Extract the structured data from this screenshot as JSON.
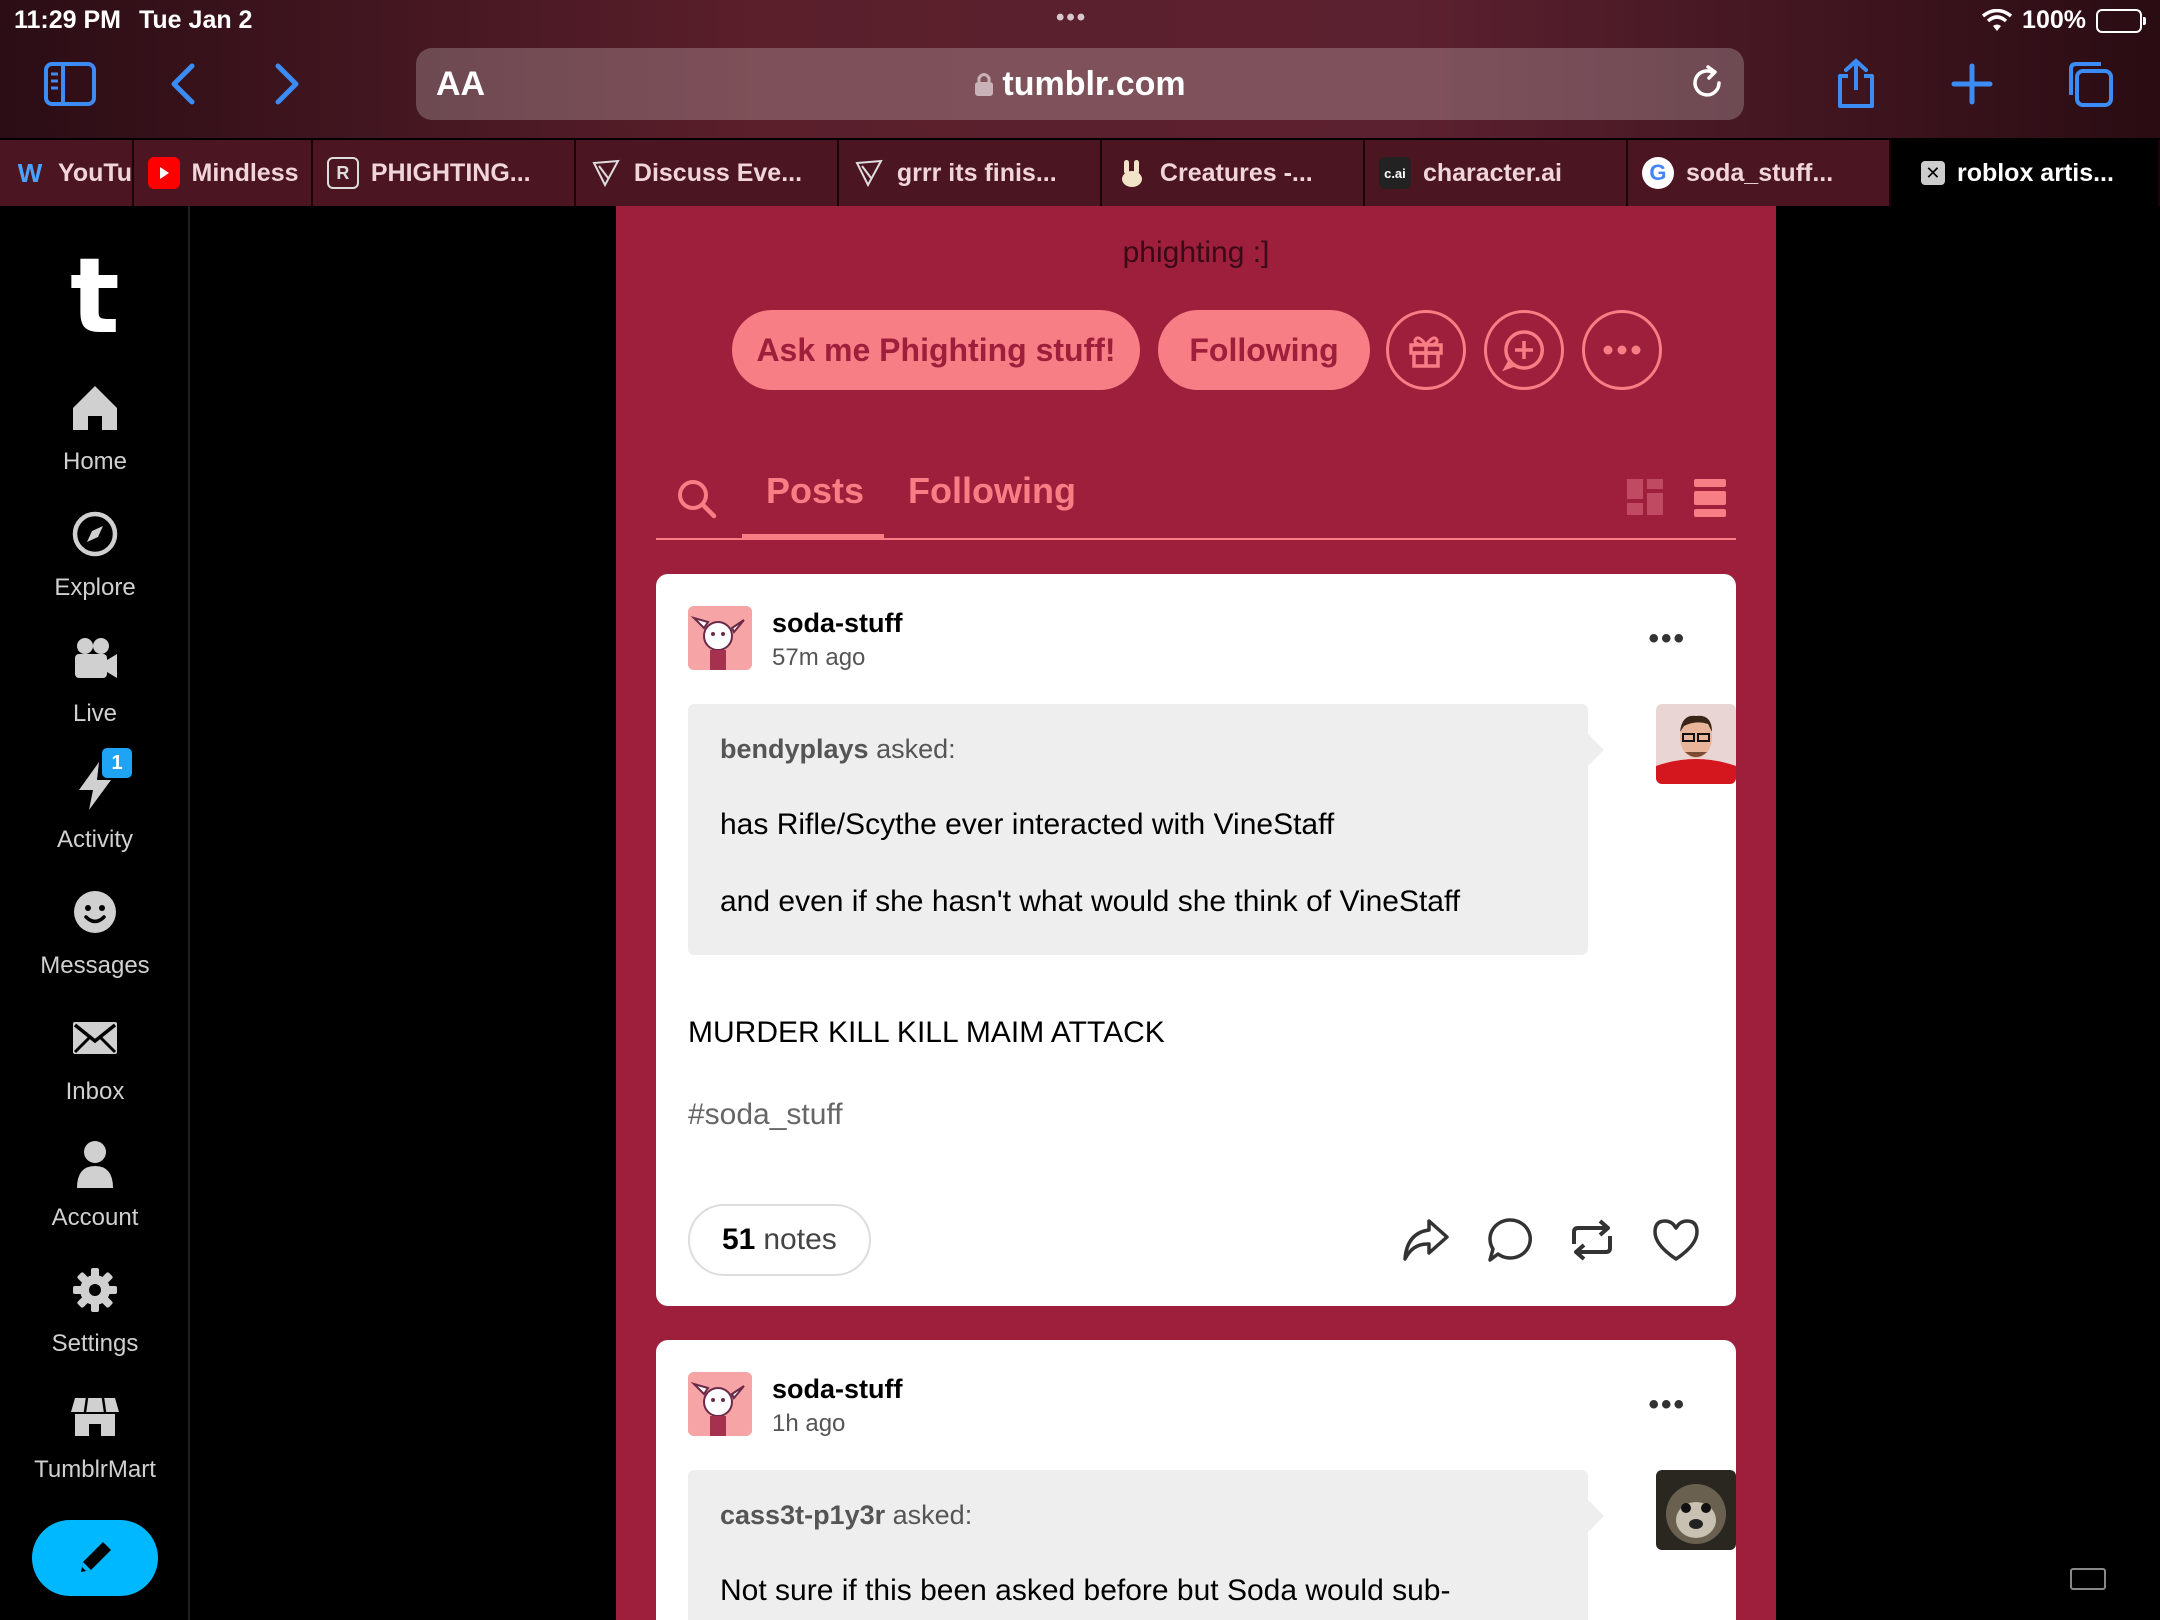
{
  "status": {
    "time": "11:29 PM",
    "date": "Tue Jan 2",
    "battery": "100%"
  },
  "browser": {
    "text_size": "AA",
    "url": "tumblr.com",
    "tabs": [
      {
        "label": "YouTu",
        "icon": "w-icon"
      },
      {
        "label": "Mindless",
        "icon": "youtube-icon"
      },
      {
        "label": "PHIGHTING...",
        "icon": "r-icon"
      },
      {
        "label": "Discuss Eve...",
        "icon": "feather-icon"
      },
      {
        "label": "grrr its finis...",
        "icon": "feather-icon"
      },
      {
        "label": "Creatures -...",
        "icon": "bunny-icon"
      },
      {
        "label": "character.ai",
        "icon": "c.ai"
      },
      {
        "label": "soda_stuff...",
        "icon": "google-icon"
      },
      {
        "label": "roblox artis...",
        "icon": "x-icon"
      }
    ]
  },
  "nav": {
    "items": [
      {
        "label": "Home"
      },
      {
        "label": "Explore"
      },
      {
        "label": "Live"
      },
      {
        "label": "Activity",
        "badge": "1"
      },
      {
        "label": "Messages"
      },
      {
        "label": "Inbox"
      },
      {
        "label": "Account"
      },
      {
        "label": "Settings"
      },
      {
        "label": "TumblrMart"
      }
    ]
  },
  "blog": {
    "description": "phighting :]",
    "ask_button": "Ask me Phighting stuff!",
    "following_button": "Following",
    "tabs": {
      "posts": "Posts",
      "following": "Following"
    }
  },
  "posts": [
    {
      "user": "soda-stuff",
      "time": "57m ago",
      "asker": "bendyplays",
      "asked_label": "asked:",
      "question": [
        "has Rifle/Scythe ever interacted with VineStaff",
        "and even if she hasn't what would she think of VineStaff"
      ],
      "answer": "MURDER KILL KILL MAIM ATTACK",
      "tag": "#soda_stuff",
      "notes_count": "51",
      "notes_label": "notes"
    },
    {
      "user": "soda-stuff",
      "time": "1h ago",
      "asker": "cass3t-p1y3r",
      "asked_label": "asked:",
      "question": [
        "Not sure if this been asked before but Soda would sub-"
      ]
    }
  ],
  "colors": {
    "blog_bg": "#9d1f3c",
    "accent": "#f77e84",
    "compose": "#00b8ff",
    "browser_blue": "#3b8cf5"
  }
}
